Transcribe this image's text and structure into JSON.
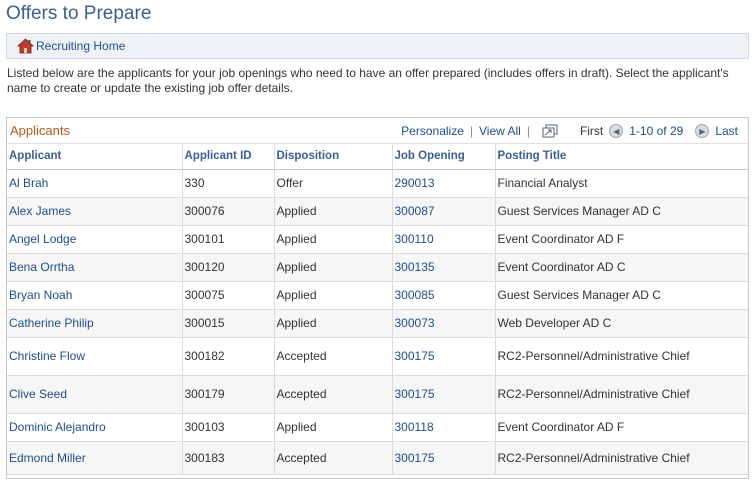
{
  "page": {
    "title": "Offers to Prepare"
  },
  "nav": {
    "home_link": "Recruiting Home",
    "home_icon": "home-icon"
  },
  "instructions": "Listed below are the applicants for your job openings who need to have an offer prepared (includes offers in draft).   Select the applicant's name to create or update the existing job offer details.",
  "grid": {
    "title": "Applicants",
    "personalize": "Personalize",
    "view_all": "View All",
    "first": "First",
    "range": "1-10 of 29",
    "last": "Last",
    "columns": [
      "Applicant",
      "Applicant ID",
      "Disposition",
      "Job Opening",
      "Posting Title"
    ],
    "rows": [
      {
        "applicant": "Al Brah",
        "id": "330",
        "disposition": "Offer",
        "job": "290013",
        "title": "Financial Analyst"
      },
      {
        "applicant": "Alex James",
        "id": "300076",
        "disposition": "Applied",
        "job": "300087",
        "title": "Guest Services Manager AD C"
      },
      {
        "applicant": "Angel Lodge",
        "id": "300101",
        "disposition": "Applied",
        "job": "300110",
        "title": "Event Coordinator AD F"
      },
      {
        "applicant": "Bena Orrtha",
        "id": "300120",
        "disposition": "Applied",
        "job": "300135",
        "title": "Event Coordinator AD C"
      },
      {
        "applicant": "Bryan Noah",
        "id": "300075",
        "disposition": "Applied",
        "job": "300085",
        "title": "Guest Services Manager AD C"
      },
      {
        "applicant": "Catherine Philip",
        "id": "300015",
        "disposition": "Applied",
        "job": "300073",
        "title": "Web Developer AD C"
      },
      {
        "applicant": "Christine Flow",
        "id": "300182",
        "disposition": "Accepted",
        "job": "300175",
        "title": "RC2-Personnel/Administrative Chief"
      },
      {
        "applicant": "Clive Seed",
        "id": "300179",
        "disposition": "Accepted",
        "job": "300175",
        "title": "RC2-Personnel/Administrative Chief"
      },
      {
        "applicant": "Dominic Alejandro",
        "id": "300103",
        "disposition": "Applied",
        "job": "300118",
        "title": "Event Coordinator AD F"
      },
      {
        "applicant": "Edmond Miller",
        "id": "300183",
        "disposition": "Accepted",
        "job": "300175",
        "title": "RC2-Personnel/Administrative Chief"
      }
    ]
  }
}
